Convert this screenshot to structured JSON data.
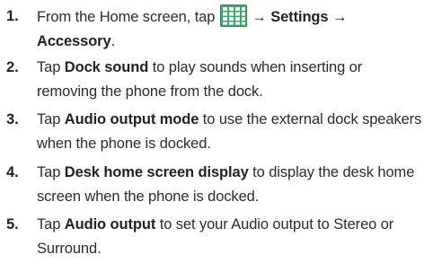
{
  "top_fragment": "",
  "steps": [
    {
      "number": "1.",
      "t1": "From the Home screen, tap ",
      "icon": "apps-grid-icon",
      "arrow1": " → ",
      "bold1": "Settings",
      "arrow2": " → ",
      "bold2": "Accessory",
      "t2": "."
    },
    {
      "number": "2.",
      "t1": "Tap ",
      "bold1": "Dock sound",
      "t2": " to play sounds when inserting or removing the phone from the dock."
    },
    {
      "number": "3.",
      "t1": "Tap ",
      "bold1": "Audio output mode",
      "t2": " to use the external dock speakers when the phone is docked."
    },
    {
      "number": "4.",
      "t1": "Tap ",
      "bold1": "Desk home screen display",
      "t2": " to display the desk home screen when the phone is docked."
    },
    {
      "number": "5.",
      "t1": "Tap ",
      "bold1": "Audio output",
      "t2": " to set your Audio output to Stereo or Surround."
    }
  ],
  "colors": {
    "icon_fill": "#3aaa6a",
    "icon_border": "#2b8f55",
    "text": "#2b2b2b"
  }
}
